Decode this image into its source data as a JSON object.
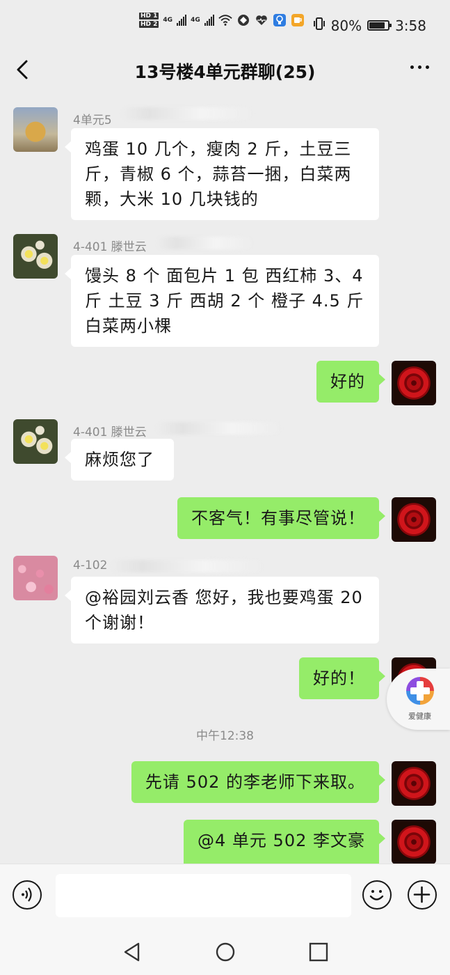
{
  "status_bar": {
    "hd1": "HD 1",
    "hd2": "HD 2",
    "net1": "4G",
    "net2": "4G",
    "battery_percent": "80%",
    "time": "3:58"
  },
  "header": {
    "title": "13号楼4单元群聊(25)",
    "back_icon": "chevron-left-icon",
    "more_icon": "more-dots-icon"
  },
  "messages": [
    {
      "sender": "4单元5",
      "text": "鸡蛋 10 几个，瘦肉 2 斤，土豆三斤，青椒 6 个，蒜苔一捆，白菜两颗，大米 10 几块钱的"
    },
    {
      "sender": "4-401  滕世云",
      "text": "馒头 8 个   面包片 1 包  西红柿 3、4 斤   土豆 3 斤   西胡 2 个   橙子 4.5 斤   白菜两小棵"
    },
    {
      "text": "好的"
    },
    {
      "sender": "4-401  滕世云",
      "text": "麻烦您了"
    },
    {
      "text": "不客气！有事尽管说！"
    },
    {
      "sender": "4-102",
      "text": "@裕园刘云香  您好，我也要鸡蛋 20 个谢谢！"
    },
    {
      "text": "好的！"
    },
    {
      "text": "先请 502 的李老师下来取。"
    },
    {
      "text": "@4 单元 502 李文豪"
    }
  ],
  "timestamp": "中午12:38",
  "floating_badge": {
    "label": "爱健康",
    "icon": "health-cross-icon"
  },
  "input_bar": {
    "voice_icon": "voice-icon",
    "emoji_icon": "emoji-icon",
    "plus_icon": "plus-icon",
    "placeholder": ""
  },
  "nav_bar": {
    "back_icon": "nav-back-icon",
    "home_icon": "nav-home-icon",
    "recents_icon": "nav-recents-icon"
  },
  "colors": {
    "background": "#ededed",
    "outgoing_bubble": "#95ec69",
    "incoming_bubble": "#ffffff"
  }
}
